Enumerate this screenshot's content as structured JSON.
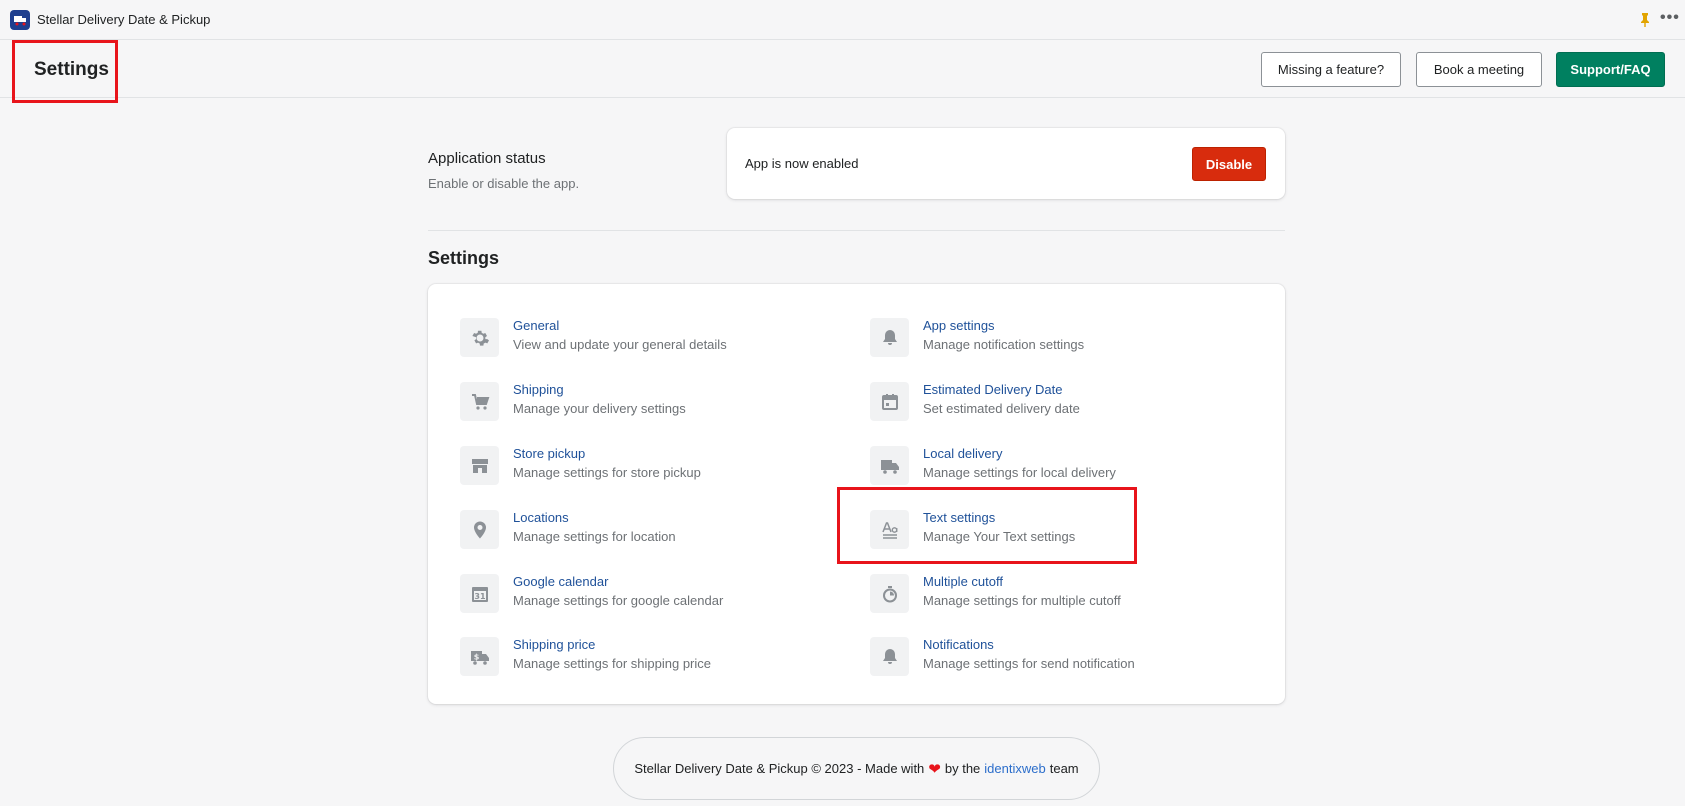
{
  "app": {
    "title": "Stellar Delivery Date & Pickup",
    "logo_icon": "app-logo-icon",
    "pin_icon": "pin-icon",
    "more_label": "•••"
  },
  "header": {
    "title": "Settings",
    "buttons": {
      "missing_feature": "Missing a feature?",
      "book_meeting": "Book a meeting",
      "support": "Support/FAQ"
    }
  },
  "status": {
    "title": "Application status",
    "description": "Enable or disable the app.",
    "state_text": "App is now enabled",
    "disable_label": "Disable"
  },
  "settings": {
    "heading": "Settings",
    "left": [
      {
        "title": "General",
        "desc": "View and update your general details",
        "icon": "gear-icon"
      },
      {
        "title": "Shipping",
        "desc": "Manage your delivery settings",
        "icon": "cart-icon"
      },
      {
        "title": "Store pickup",
        "desc": "Manage settings for store pickup",
        "icon": "store-icon"
      },
      {
        "title": "Locations",
        "desc": "Manage settings for location",
        "icon": "location-pin-icon"
      },
      {
        "title": "Google calendar",
        "desc": "Manage settings for google calendar",
        "icon": "calendar-31-icon"
      },
      {
        "title": "Shipping price",
        "desc": "Manage settings for shipping price",
        "icon": "truck-dollar-icon"
      }
    ],
    "right": [
      {
        "title": "App settings",
        "desc": "Manage notification settings",
        "icon": "bell-icon"
      },
      {
        "title": "Estimated Delivery Date",
        "desc": "Set estimated delivery date",
        "icon": "calendar-icon"
      },
      {
        "title": "Local delivery",
        "desc": "Manage settings for local delivery",
        "icon": "truck-icon"
      },
      {
        "title": "Text settings",
        "desc": "Manage Your Text settings",
        "icon": "text-icon"
      },
      {
        "title": "Multiple cutoff",
        "desc": "Manage settings for multiple cutoff",
        "icon": "stopwatch-icon"
      },
      {
        "title": "Notifications",
        "desc": "Manage settings for send notification",
        "icon": "bell-icon"
      }
    ]
  },
  "footer": {
    "prefix": "Stellar Delivery Date & Pickup © 2023 - Made with",
    "heart": "❤",
    "by": "by the",
    "link": "identixweb",
    "suffix": "team"
  },
  "colors": {
    "primary": "#008060",
    "critical": "#d82c0d",
    "link": "#1f5199",
    "highlight": "#e8141b"
  }
}
